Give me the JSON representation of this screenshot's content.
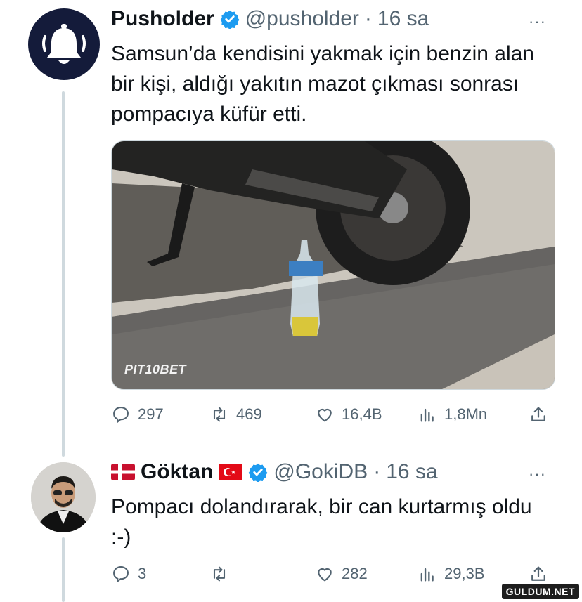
{
  "tweets": [
    {
      "name": "Pusholder",
      "handle": "@pusholder",
      "time": "16 sa",
      "text": "Samsun’da kendisini yakmak için benzin alan bir kişi, aldığı yakıtın mazot çıkması sonrası pompacıya küfür etti.",
      "media_watermark": "PIT10BET",
      "stats": {
        "replies": "297",
        "retweets": "469",
        "likes": "16,4B",
        "views": "1,8Mn"
      }
    },
    {
      "name": "Göktan",
      "handle": "@GokiDB",
      "time": "16 sa",
      "text": "Pompacı dolandırarak, bir can kurtarmış oldu :-)",
      "stats": {
        "replies": "3",
        "retweets": "",
        "likes": "282",
        "views": "29,3B"
      }
    }
  ],
  "separator": "·",
  "more_label": "···",
  "site_watermark": "GULDUM.NET",
  "colors": {
    "blue": "#1d9bf0",
    "muted": "#536471",
    "line": "#cfd9de",
    "avatar_bg": "#141b3a"
  },
  "icons": {
    "bell": "bell-icon",
    "verified": "verified-badge-icon",
    "reply": "reply-icon",
    "retweet": "retweet-icon",
    "like": "heart-icon",
    "views": "views-icon",
    "share": "share-icon"
  }
}
